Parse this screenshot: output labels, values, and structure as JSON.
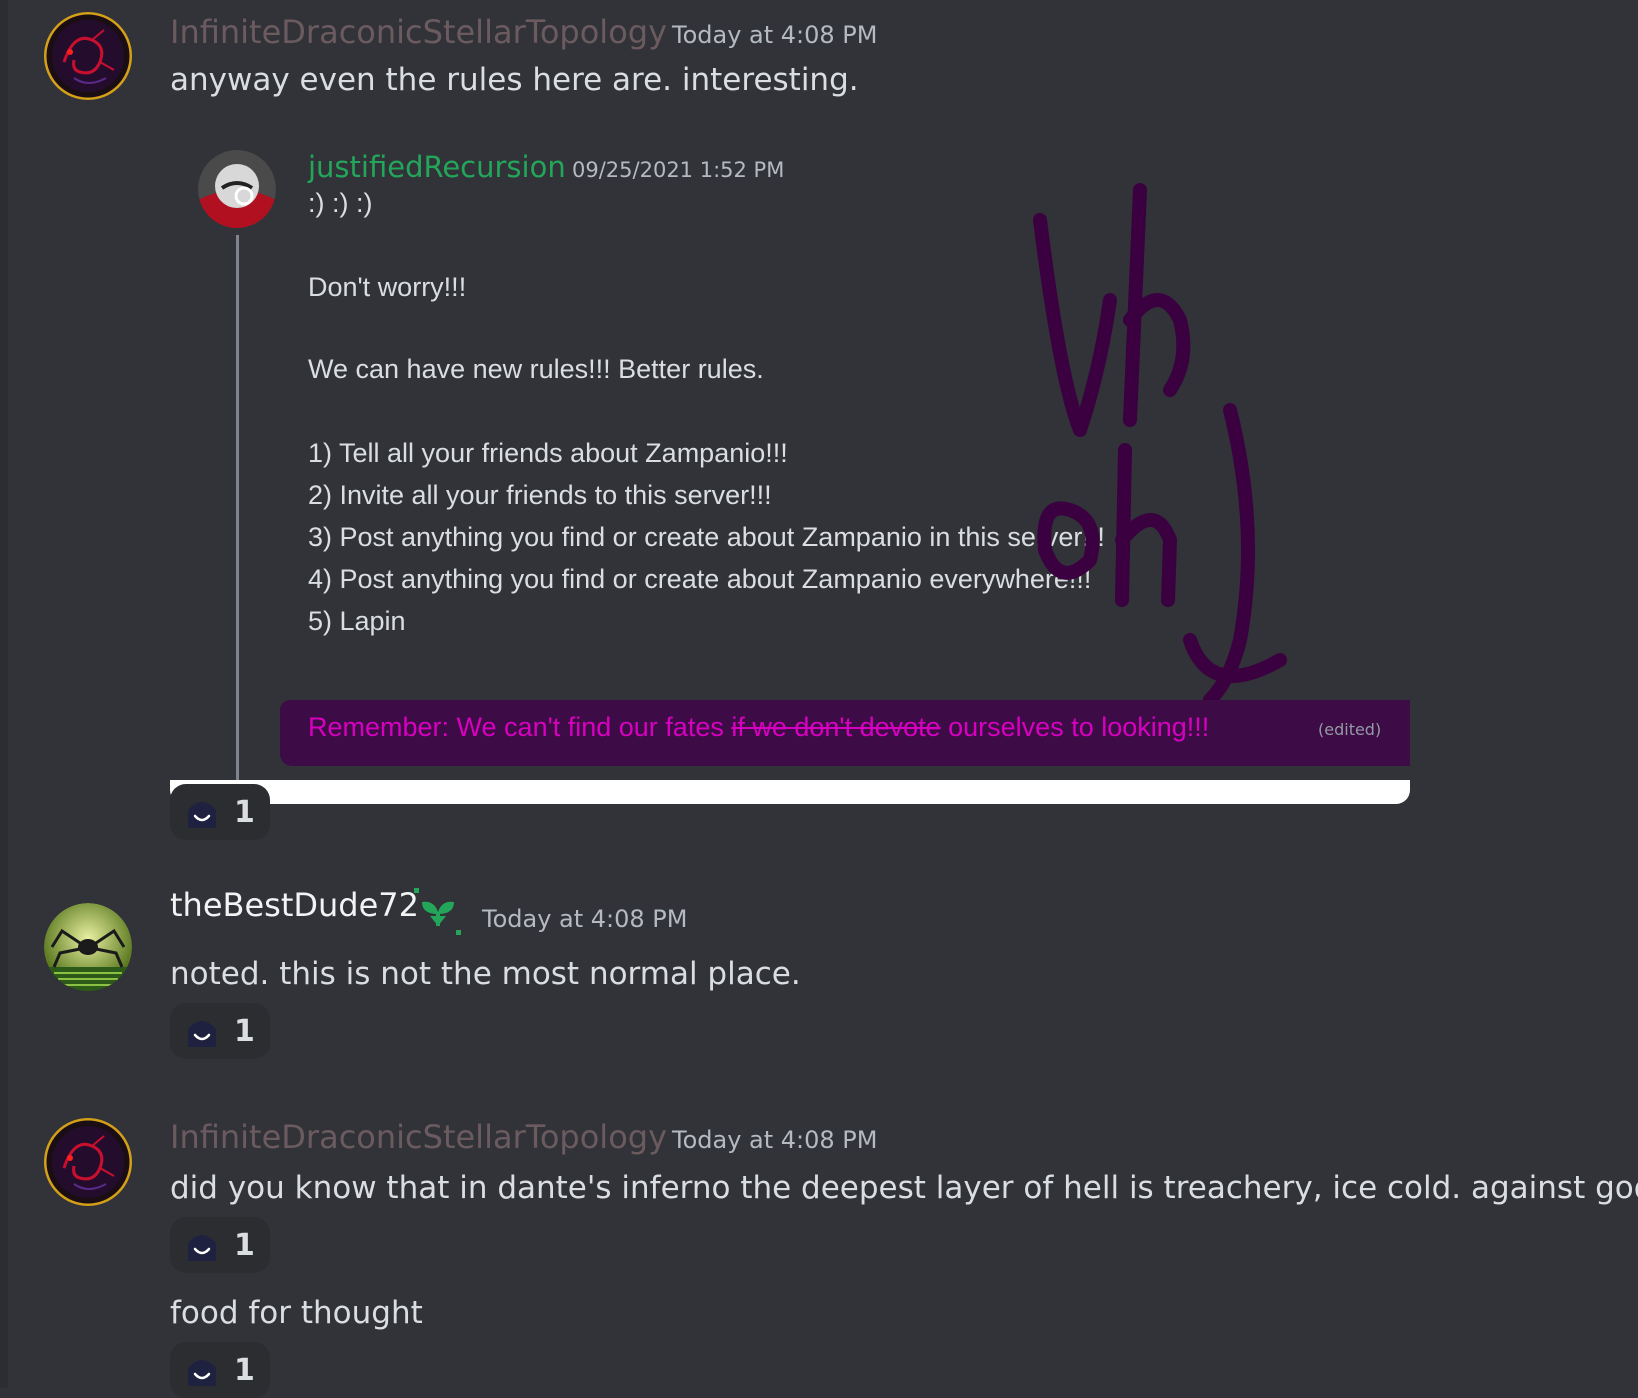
{
  "messages": [
    {
      "author": "InfiniteDraconicStellarTopology",
      "author_color": "#6b5b5f",
      "timestamp": "Today at 4:08 PM",
      "text": "anyway even the rules here are. interesting.",
      "reaction_count": "1"
    },
    {
      "author": "theBestDude72",
      "author_color": "#f2f3f5",
      "timestamp": "Today at 4:08 PM",
      "text": "noted. this is not the most normal place.",
      "reaction_count": "1"
    },
    {
      "author": "InfiniteDraconicStellarTopology",
      "author_color": "#6b5b5f",
      "timestamp": "Today at 4:08 PM",
      "text": "did you know that in dante's inferno the deepest layer of hell is treachery, ice cold. against god.",
      "reaction_count": "1",
      "followup_text": "food for thought",
      "followup_reaction_count": "1"
    }
  ],
  "quoted": {
    "author": "justifiedRecursion",
    "timestamp": "09/25/2021 1:52 PM",
    "lines": [
      ":) :) :)",
      "Don't worry!!!",
      "We can have new rules!!! Better rules.",
      "1)  Tell all your friends about Zampanio!!!",
      "2) Invite all your friends to this server!!!",
      "3) Post anything you find or create about Zampanio in this server!!!",
      "4) Post anything you find or create about Zampanio everywhere!!!",
      "5) Lapin"
    ],
    "remember_part1": "Remember: We can't find our fates ",
    "remember_strike": "if we don't devote",
    "remember_part2": " ourselves to looking!!!",
    "edited": "(edited)",
    "scribble_text": "uh oh"
  },
  "colors": {
    "background": "#313338",
    "reaction_bg": "#2b2d31",
    "quoted_author": "#23a55a",
    "remember_text": "#d800c0",
    "scribble": "#3a0040"
  },
  "icons": {
    "reaction_emoji": "hooded-smile-emoji",
    "badge": "sprout-badge-icon"
  }
}
